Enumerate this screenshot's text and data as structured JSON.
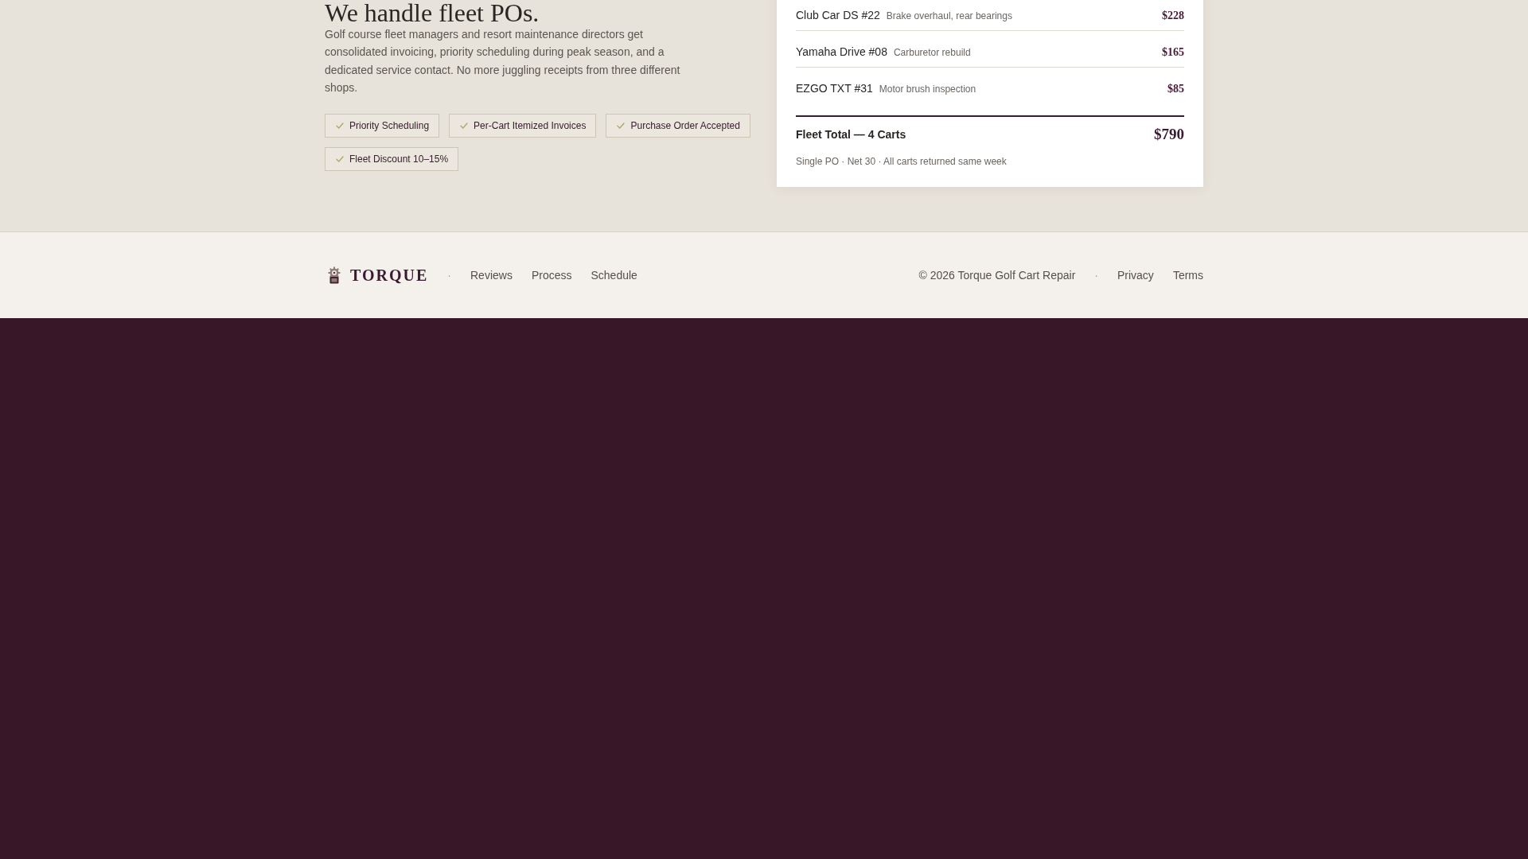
{
  "hero": {
    "heading": "We handle fleet POs.",
    "description": "Golf course fleet managers and resort maintenance directors get consolidated invoicing, priority scheduling during peak season, and a dedicated service contact. No more juggling receipts from three different shops.",
    "tags": [
      "Priority Scheduling",
      "Per-Cart Itemized Invoices",
      "Purchase Order Accepted",
      "Fleet Discount 10–15%"
    ]
  },
  "invoice": {
    "items": [
      {
        "cart": "Club Car DS #22",
        "service": "Brake overhaul, rear bearings",
        "price": "$228"
      },
      {
        "cart": "Yamaha Drive #08",
        "service": "Carburetor rebuild",
        "price": "$165"
      },
      {
        "cart": "EZGO TXT #31",
        "service": "Motor brush inspection",
        "price": "$85"
      }
    ],
    "total_label": "Fleet Total — 4 Carts",
    "total": "$790",
    "note": "Single PO · Net 30 · All carts returned same week"
  },
  "footer": {
    "brand": "TORQUE",
    "separator": "·",
    "links": [
      "Reviews",
      "Process",
      "Schedule"
    ],
    "copyright": "© 2026 Torque Golf Cart Repair",
    "legal_separator": "·",
    "legal_links": [
      "Privacy",
      "Terms"
    ]
  }
}
